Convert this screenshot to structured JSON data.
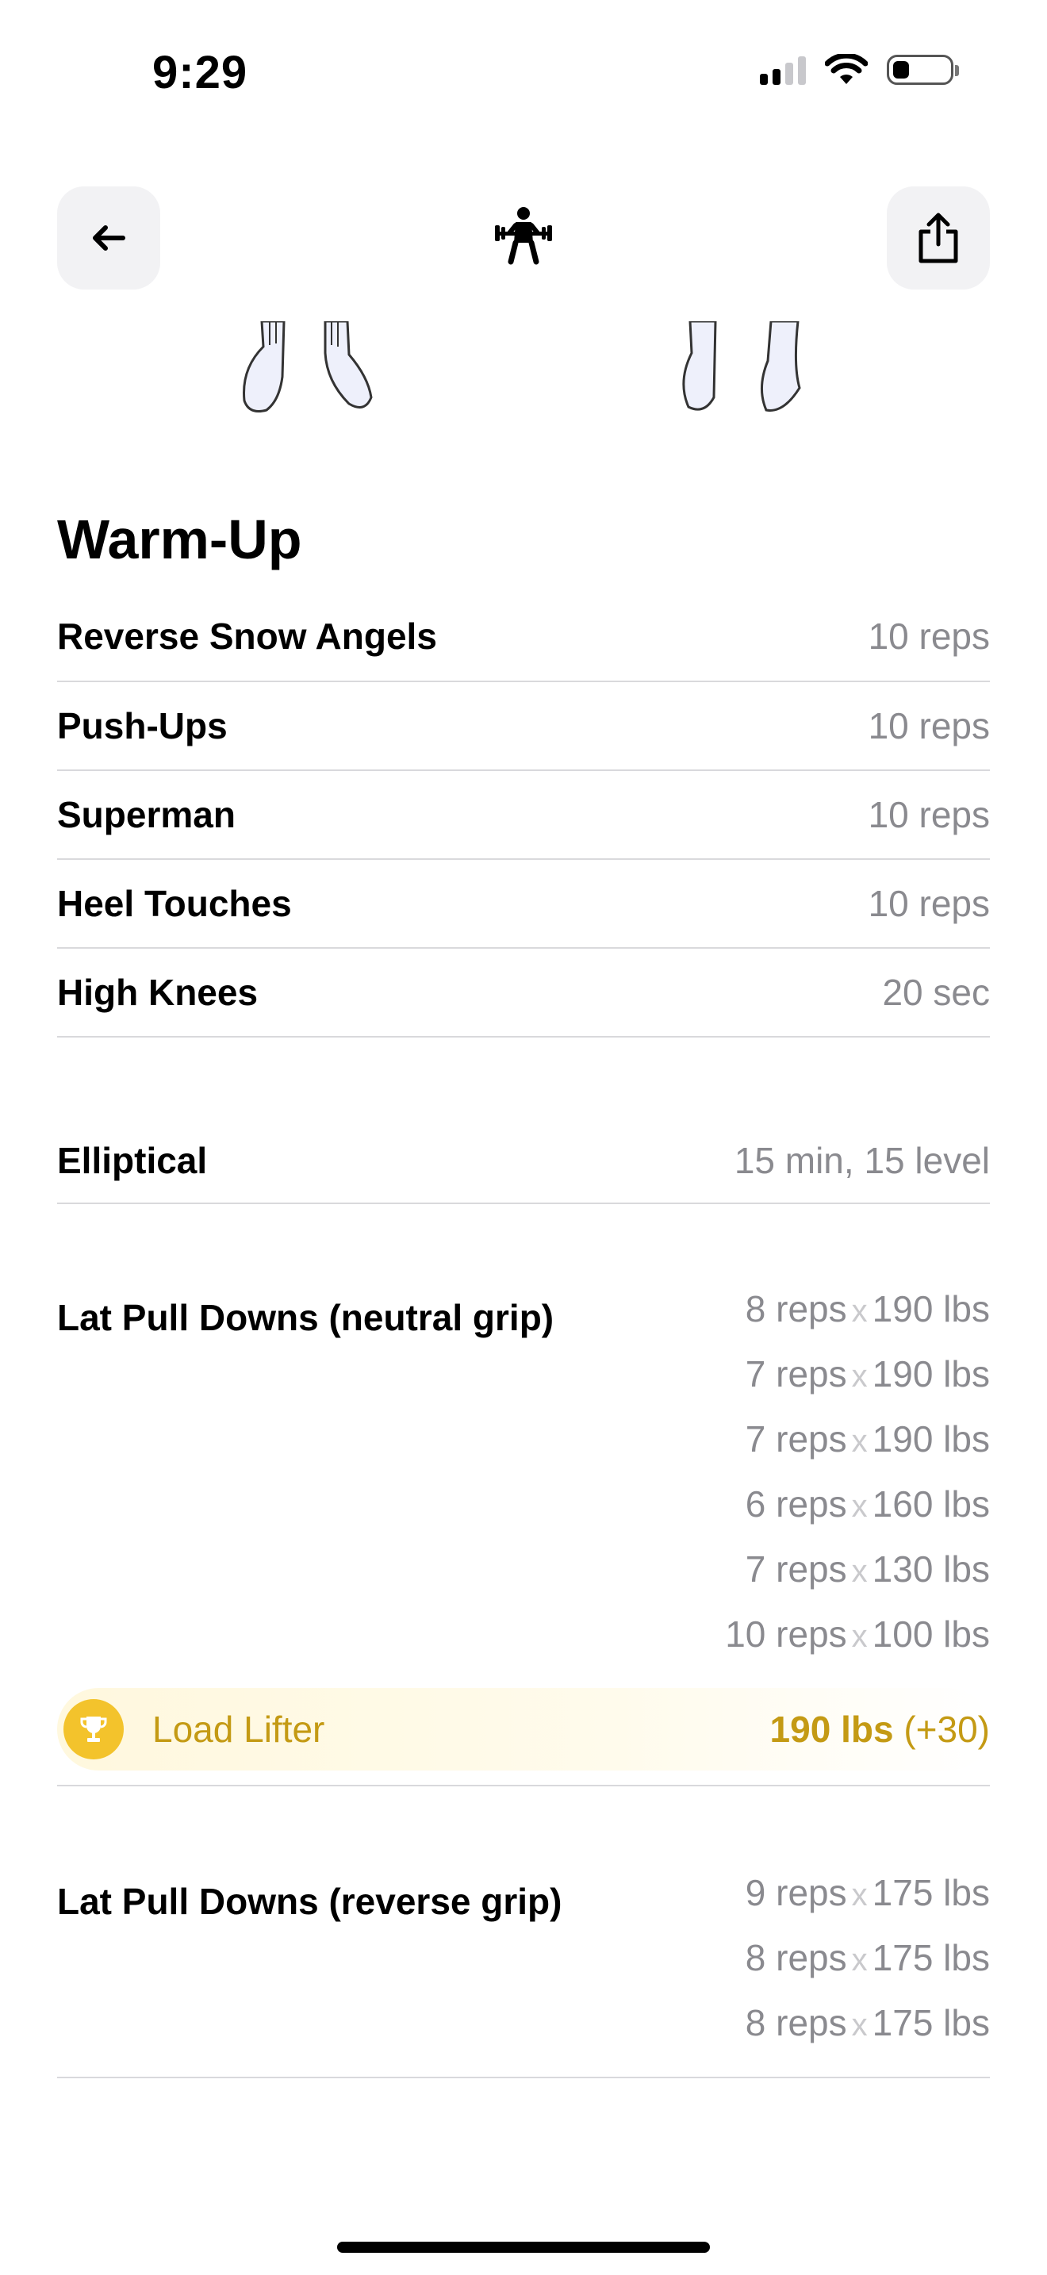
{
  "status_bar": {
    "time": "9:29"
  },
  "header": {
    "back_icon": "arrow-left-icon",
    "center_icon": "weightlifter-icon",
    "share_icon": "share-icon"
  },
  "warmup": {
    "title": "Warm-Up",
    "items": [
      {
        "name": "Reverse Snow Angels",
        "value": "10 reps"
      },
      {
        "name": "Push-Ups",
        "value": "10 reps"
      },
      {
        "name": "Superman",
        "value": "10 reps"
      },
      {
        "name": "Heel Touches",
        "value": "10 reps"
      },
      {
        "name": "High Knees",
        "value": "20 sec"
      }
    ]
  },
  "cardio": {
    "name": "Elliptical",
    "value": "15 min, 15 level"
  },
  "exercises": [
    {
      "name": "Lat Pull Downs (neutral grip)",
      "sets": [
        {
          "reps": "8 reps",
          "weight": "190 lbs"
        },
        {
          "reps": "7 reps",
          "weight": "190 lbs"
        },
        {
          "reps": "7 reps",
          "weight": "190 lbs"
        },
        {
          "reps": "6 reps",
          "weight": "160 lbs"
        },
        {
          "reps": "7 reps",
          "weight": "130 lbs"
        },
        {
          "reps": "10 reps",
          "weight": "100 lbs"
        }
      ],
      "achievement": {
        "label": "Load Lifter",
        "value": "190 lbs",
        "delta": "(+30)",
        "color": "#c49a14"
      }
    },
    {
      "name": "Lat Pull Downs (reverse grip)",
      "sets": [
        {
          "reps": "9 reps",
          "weight": "175 lbs"
        },
        {
          "reps": "8 reps",
          "weight": "175 lbs"
        },
        {
          "reps": "8 reps",
          "weight": "175 lbs"
        }
      ]
    }
  ],
  "set_separator": "x"
}
